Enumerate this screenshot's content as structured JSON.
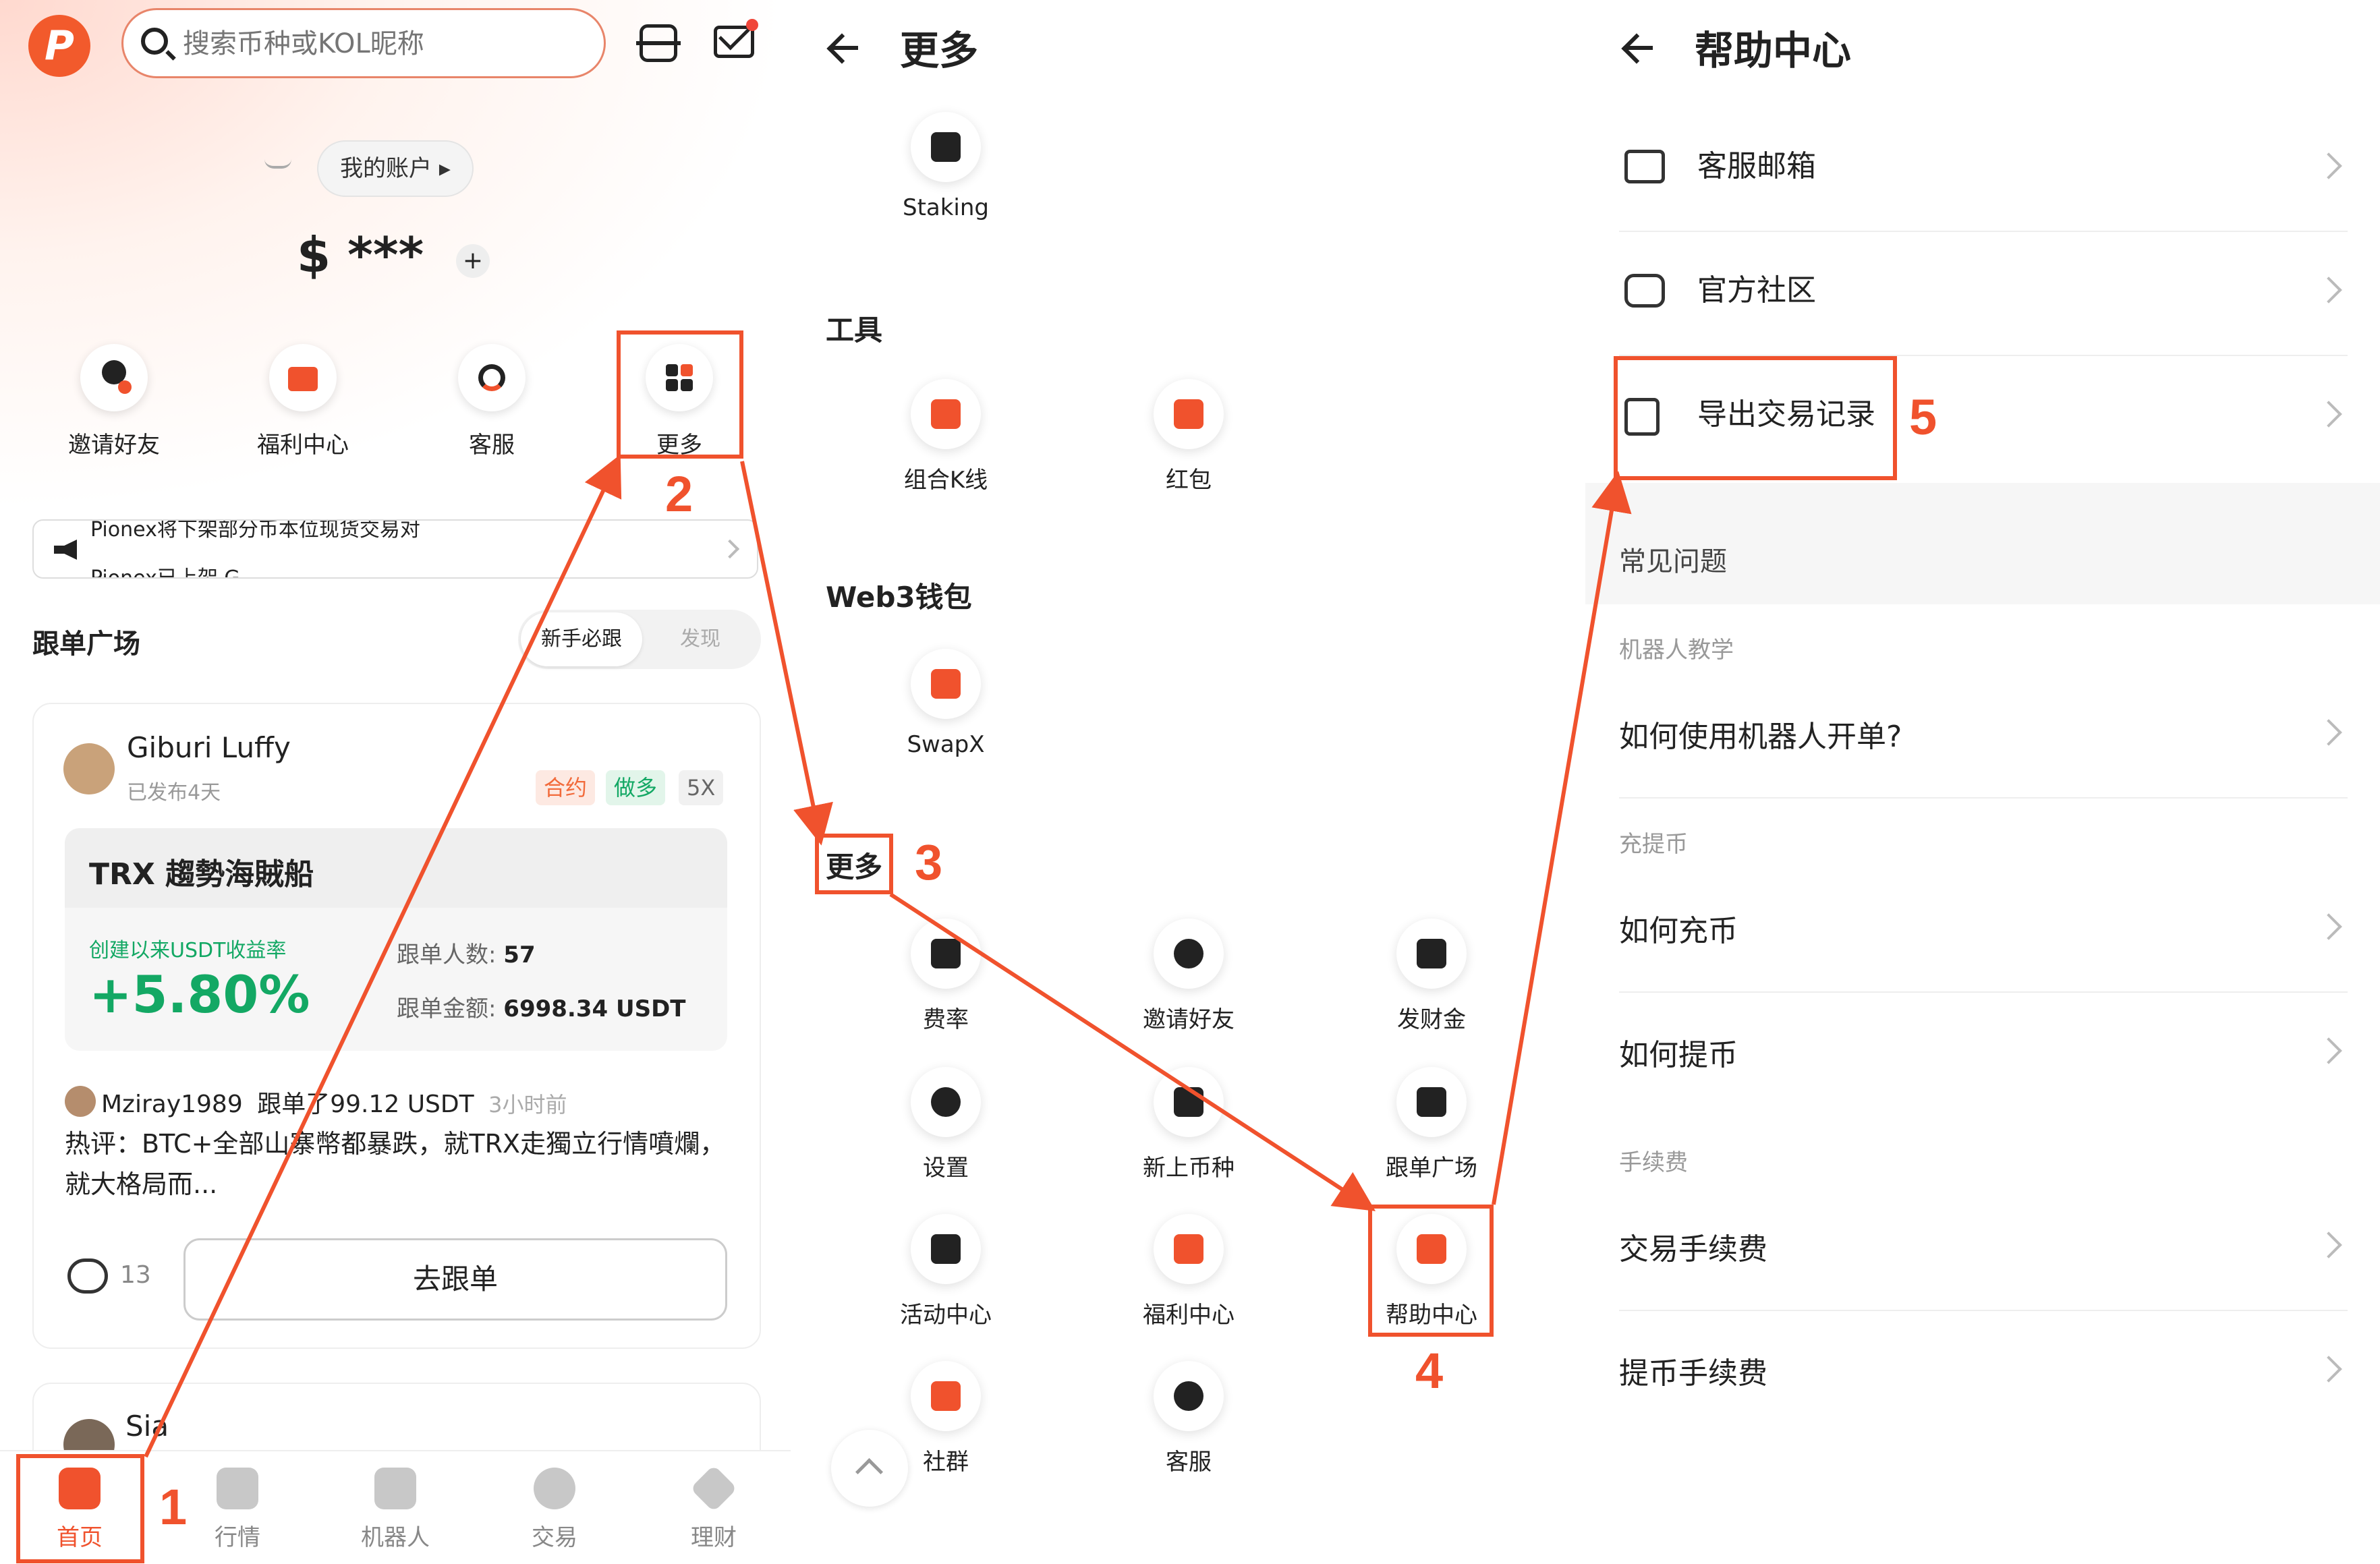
{
  "panel1": {
    "search_placeholder": "搜索币种或KOL昵称",
    "account_label": "我的账户 ▸",
    "balance_masked": "$ ***",
    "balance_plus": "+",
    "quick_actions": [
      "邀请好友",
      "福利中心",
      "客服",
      "更多"
    ],
    "notice_lines": [
      "Pionex将下架部分币本位现货交易对",
      "Pionex已上架 G"
    ],
    "copy_section_title": "跟单广场",
    "segment_active": "新手必跟",
    "segment_inactive": "发现",
    "card": {
      "author": "Giburi Luffy",
      "posted": "已发布4天",
      "tags": [
        "合约",
        "做多",
        "5X"
      ],
      "strategy": "TRX 趨勢海賊船",
      "roi_label": "创建以来USDT收益率",
      "roi_value": "+5.80%",
      "followers_label": "跟单人数:",
      "followers_value": "57",
      "amount_label": "跟单金额:",
      "amount_value": "6998.34 USDT",
      "follower_name": "Mziray1989",
      "follower_action": "跟单了99.12 USDT",
      "follower_time": "3小时前",
      "comment": "热评：BTC+全部山寨幣都暴跌，就TRX走獨立行情噴爛，就大格局而...",
      "comment_count": "13",
      "follow_button": "去跟单"
    },
    "card2_author": "Sia",
    "tabs": [
      "首页",
      "行情",
      "机器人",
      "交易",
      "理财"
    ]
  },
  "panel2": {
    "title": "更多",
    "staking": "Staking",
    "group_tools": "工具",
    "tools": [
      "组合K线",
      "红包"
    ],
    "group_web3": "Web3钱包",
    "web3": [
      "SwapX"
    ],
    "group_more": "更多",
    "more": [
      "费率",
      "邀请好友",
      "发财金",
      "设置",
      "新上币种",
      "跟单广场",
      "活动中心",
      "福利中心",
      "帮助中心",
      "社群",
      "客服"
    ]
  },
  "panel3": {
    "title": "帮助中心",
    "rows": [
      "客服邮箱",
      "官方社区",
      "导出交易记录"
    ],
    "faq_title": "常见问题",
    "cat_bot": "机器人教学",
    "q_bot": "如何使用机器人开单?",
    "cat_deposit": "充提币",
    "q_deposit": "如何充币",
    "q_withdraw": "如何提币",
    "cat_fee": "手续费",
    "q_trade_fee": "交易手续费",
    "q_withdraw_fee": "提币手续费"
  },
  "steps": [
    "1",
    "2",
    "3",
    "4",
    "5"
  ],
  "colors": {
    "accent": "#f0522d",
    "profit": "#13a864",
    "tag_contract": "#f26a3a",
    "tag_long": "#13a864"
  }
}
